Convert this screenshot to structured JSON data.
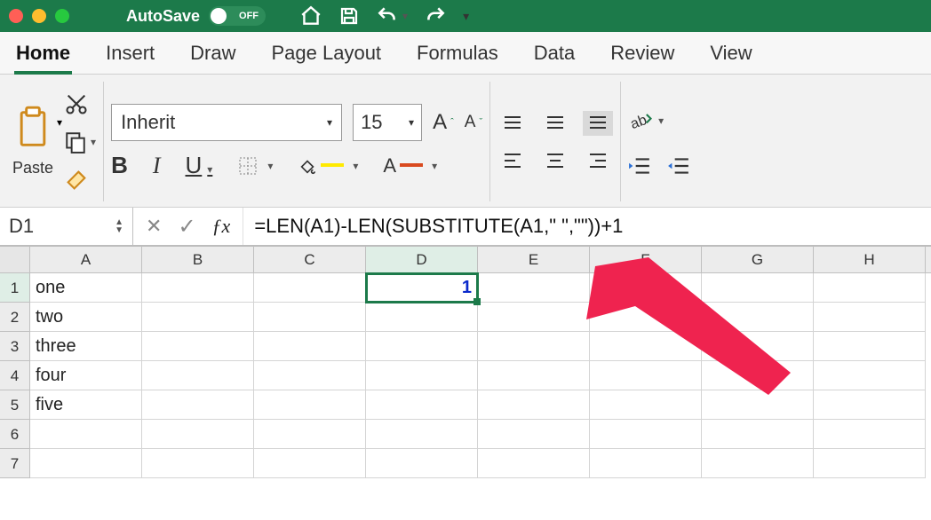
{
  "titlebar": {
    "autosave_label": "AutoSave",
    "autosave_state": "OFF"
  },
  "tabs": [
    "Home",
    "Insert",
    "Draw",
    "Page Layout",
    "Formulas",
    "Data",
    "Review",
    "View"
  ],
  "active_tab": "Home",
  "ribbon": {
    "paste_label": "Paste",
    "font_name": "Inherit",
    "font_size": "15",
    "bold": "B",
    "italic": "I",
    "underline": "U"
  },
  "namebox": "D1",
  "formula": "=LEN(A1)-LEN(SUBSTITUTE(A1,\" \",\"\"))+1",
  "columns": [
    "A",
    "B",
    "C",
    "D",
    "E",
    "F",
    "G",
    "H"
  ],
  "rows": [
    {
      "n": "1",
      "cells": [
        "one",
        "",
        "",
        "1",
        "",
        "",
        "",
        ""
      ]
    },
    {
      "n": "2",
      "cells": [
        "two",
        "",
        "",
        "",
        "",
        "",
        "",
        ""
      ]
    },
    {
      "n": "3",
      "cells": [
        "three",
        "",
        "",
        "",
        "",
        "",
        "",
        ""
      ]
    },
    {
      "n": "4",
      "cells": [
        "four",
        "",
        "",
        "",
        "",
        "",
        "",
        ""
      ]
    },
    {
      "n": "5",
      "cells": [
        "five",
        "",
        "",
        "",
        "",
        "",
        "",
        ""
      ]
    },
    {
      "n": "6",
      "cells": [
        "",
        "",
        "",
        "",
        "",
        "",
        "",
        ""
      ]
    },
    {
      "n": "7",
      "cells": [
        "",
        "",
        "",
        "",
        "",
        "",
        "",
        ""
      ]
    }
  ],
  "selected_cell": {
    "row": 0,
    "col": 3
  }
}
